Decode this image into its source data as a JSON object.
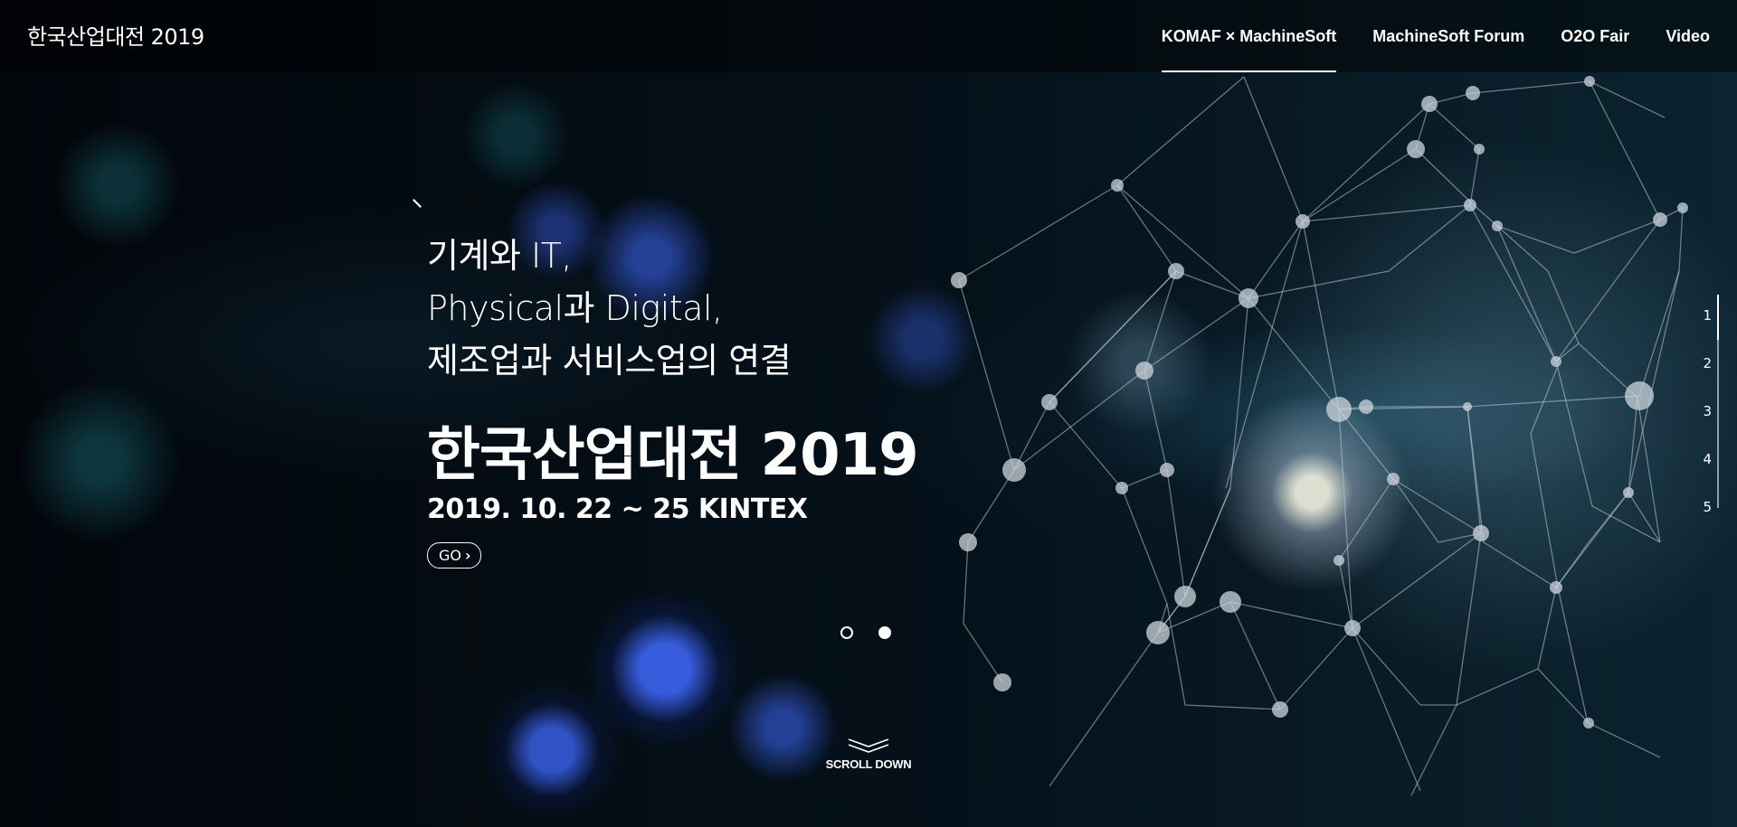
{
  "header": {
    "logo": "한국산업대전 2019",
    "nav": [
      {
        "label": "KOMAF × MachineSoft",
        "active": true
      },
      {
        "label": "MachineSoft Forum",
        "active": false
      },
      {
        "label": "O2O Fair",
        "active": false
      },
      {
        "label": "Video",
        "active": false
      }
    ]
  },
  "hero": {
    "tagline": [
      "기계와 IT,",
      "Physical과 Digital,",
      "제조업과 서비스업의 연결"
    ],
    "title": "한국산업대전 2019",
    "date": "2019. 10. 22 ~ 25 KINTEX",
    "go_label": "GO",
    "go_icon": "chevron-right-icon"
  },
  "slider": {
    "dots": [
      "hollow",
      "filled"
    ]
  },
  "scroll": {
    "label": "SCROLL DOWN",
    "icon": "double-chevron-down-icon"
  },
  "pager": {
    "items": [
      "1",
      "2",
      "3",
      "4",
      "5"
    ],
    "active": "1"
  },
  "colors": {
    "background": "#03070c",
    "text": "#ffffff",
    "glow_blue": "#3f69ff",
    "network_line": "#aebcc8"
  }
}
